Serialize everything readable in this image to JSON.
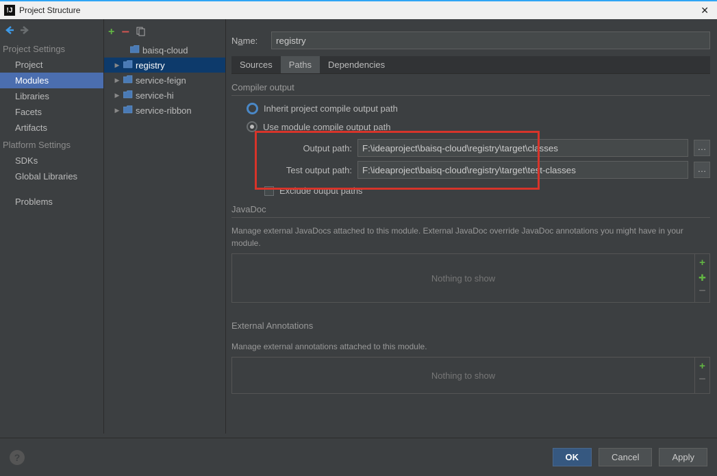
{
  "window": {
    "title": "Project Structure"
  },
  "sidebar": {
    "headings": {
      "project": "Project Settings",
      "platform": "Platform Settings"
    },
    "project_items": [
      "Project",
      "Modules",
      "Libraries",
      "Facets",
      "Artifacts"
    ],
    "platform_items": [
      "SDKs",
      "Global Libraries"
    ],
    "problems": "Problems"
  },
  "tree": {
    "items": [
      {
        "label": "baisq-cloud",
        "expandable": false
      },
      {
        "label": "registry",
        "expandable": true,
        "selected": true
      },
      {
        "label": "service-feign",
        "expandable": true
      },
      {
        "label": "service-hi",
        "expandable": true
      },
      {
        "label": "service-ribbon",
        "expandable": true
      }
    ]
  },
  "content": {
    "name_label": "Name:",
    "name_value": "registry",
    "tabs": [
      "Sources",
      "Paths",
      "Dependencies"
    ],
    "compiler_heading": "Compiler output",
    "radio_inherit": "Inherit project compile output path",
    "radio_module": "Use module compile output path",
    "output_label": "Output path:",
    "output_value": "F:\\ideaproject\\baisq-cloud\\registry\\target\\classes",
    "test_output_label": "Test output path:",
    "test_output_value": "F:\\ideaproject\\baisq-cloud\\registry\\target\\test-classes",
    "exclude_label": "Exclude output paths",
    "javadoc_heading": "JavaDoc",
    "javadoc_desc": "Manage external JavaDocs attached to this module. External JavaDoc override JavaDoc annotations you might have in your module.",
    "nothing": "Nothing to show",
    "ext_heading": "External Annotations",
    "ext_desc": "Manage external annotations attached to this module."
  },
  "footer": {
    "ok": "OK",
    "cancel": "Cancel",
    "apply": "Apply"
  }
}
